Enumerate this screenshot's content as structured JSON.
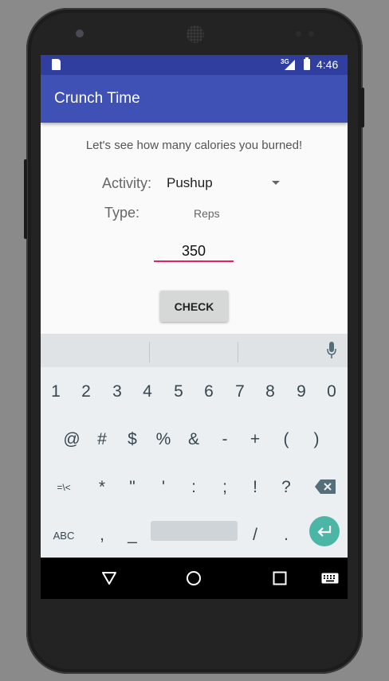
{
  "status_bar": {
    "network": "3G",
    "time": "4:46"
  },
  "app_bar": {
    "title": "Crunch Time"
  },
  "form": {
    "intro": "Let's see how many calories you burned!",
    "activity_label": "Activity:",
    "activity_value": "Pushup",
    "type_label": "Type:",
    "type_value": "Reps",
    "reps_value": "350",
    "check_label": "CHECK"
  },
  "keyboard": {
    "row1": [
      "1",
      "2",
      "3",
      "4",
      "5",
      "6",
      "7",
      "8",
      "9",
      "0"
    ],
    "row2": [
      "@",
      "#",
      "$",
      "%",
      "&",
      "-",
      "+",
      "(",
      ")"
    ],
    "row3": [
      "=\\<",
      "*",
      "\"",
      "'",
      ":",
      ";",
      "!",
      "?"
    ],
    "abc_label": "ABC",
    "row4_symbols": [
      ",",
      "_",
      "/",
      "."
    ],
    "accent": "#4bb6a6"
  },
  "colors": {
    "primary": "#3f51b5",
    "primary_dark": "#303f9f",
    "accent": "#e91e63"
  }
}
